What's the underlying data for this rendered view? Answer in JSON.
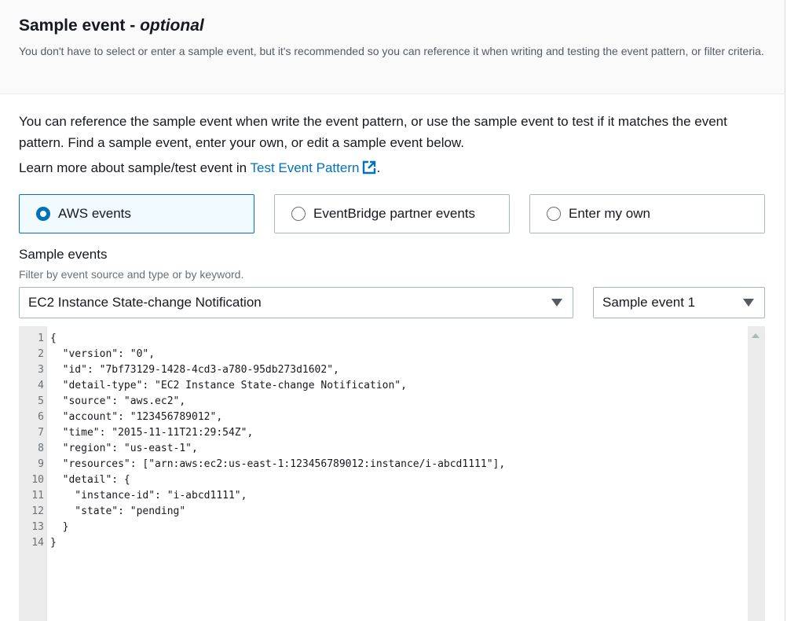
{
  "header": {
    "title": "Sample event - ",
    "title_optional": "optional",
    "description": "You don't have to select or enter a sample event, but it's recommended so you can reference it when writing and testing the event pattern, or filter criteria."
  },
  "intro": {
    "text": "You can reference the sample event when write the event pattern, or use the sample event to test if it matches the event pattern. Find a sample event, enter your own, or edit a sample event below.",
    "learn_prefix": "Learn more about sample/test event in ",
    "learn_link": "Test Event Pattern",
    "learn_suffix": "."
  },
  "event_types": {
    "selected": "AWS events",
    "options": [
      "AWS events",
      "EventBridge partner events",
      "Enter my own"
    ]
  },
  "sample_events": {
    "label": "Sample events",
    "description": "Filter by event source and type or by keyword.",
    "event_select_value": "EC2 Instance State-change Notification",
    "sample_select_value": "Sample event 1"
  },
  "editor": {
    "lines": [
      {
        "n": "1",
        "text": "{"
      },
      {
        "n": "2",
        "text": "  \"version\": \"0\","
      },
      {
        "n": "3",
        "text": "  \"id\": \"7bf73129-1428-4cd3-a780-95db273d1602\","
      },
      {
        "n": "4",
        "text": "  \"detail-type\": \"EC2 Instance State-change Notification\","
      },
      {
        "n": "5",
        "text": "  \"source\": \"aws.ec2\","
      },
      {
        "n": "6",
        "text": "  \"account\": \"123456789012\","
      },
      {
        "n": "7",
        "text": "  \"time\": \"2015-11-11T21:29:54Z\","
      },
      {
        "n": "8",
        "text": "  \"region\": \"us-east-1\","
      },
      {
        "n": "9",
        "text": "  \"resources\": [\"arn:aws:ec2:us-east-1:123456789012:instance/i-abcd1111\"],"
      },
      {
        "n": "10",
        "text": "  \"detail\": {"
      },
      {
        "n": "11",
        "text": "    \"instance-id\": \"i-abcd1111\","
      },
      {
        "n": "12",
        "text": "    \"state\": \"pending\""
      },
      {
        "n": "13",
        "text": "  }"
      },
      {
        "n": "14",
        "text": "}"
      }
    ]
  },
  "colors": {
    "accent": "#0073bb",
    "selected_bg": "#f1faff"
  }
}
